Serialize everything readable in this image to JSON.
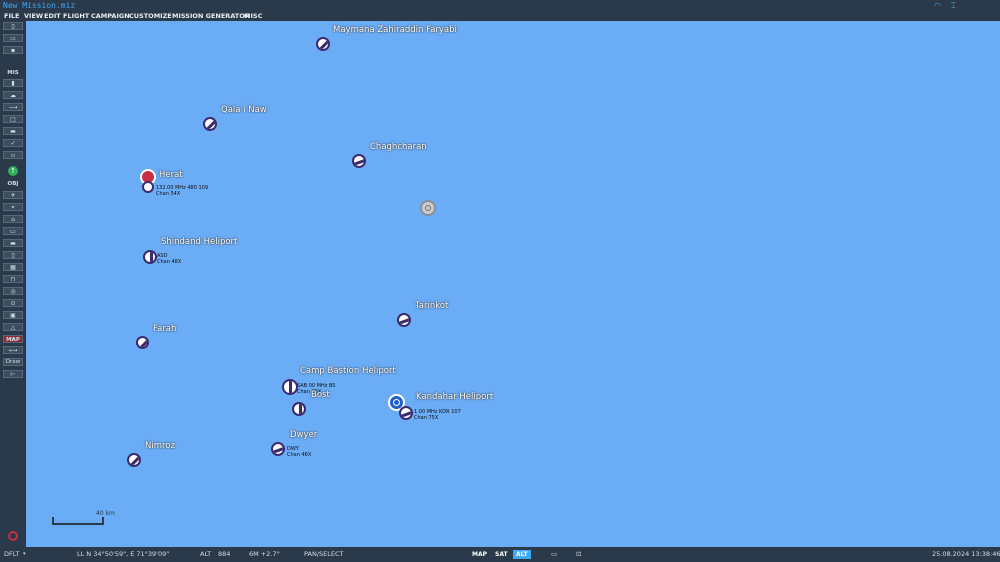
{
  "window": {
    "title": "New Mission.miz"
  },
  "menu": [
    "FILE",
    "VIEW",
    "EDIT",
    "FLIGHT",
    "CAMPAIGN",
    "CUSTOMIZE",
    "MISSION GENERATOR",
    "MISC"
  ],
  "sidebar": {
    "section_mis": "MIS",
    "section_obj": "OBJ",
    "section_map": "MAP",
    "draw_label": "Draw"
  },
  "airfields": [
    {
      "name": "Maymana Zahiraddin Faryabi"
    },
    {
      "name": "Qala i Naw"
    },
    {
      "name": "Chaghcharan"
    },
    {
      "name": "Herat",
      "info": [
        "132.00 MHz 480 109",
        "Chan 54X"
      ]
    },
    {
      "name": "Shindand Heliport",
      "info": [
        "ASD",
        "Chan 48X"
      ]
    },
    {
      "name": "Tarinkot"
    },
    {
      "name": "Farah"
    },
    {
      "name": "Camp Bastion Heliport",
      "info": [
        "SAB 00 MHz BS",
        "Chan 96X"
      ]
    },
    {
      "name": "Bost"
    },
    {
      "name": "Kandahar Heliport",
      "info": [
        "1 00 MHz KDR 107",
        "Chan 75X"
      ]
    },
    {
      "name": "Dwyer",
      "info": [
        "DWY",
        "Chan 46X"
      ]
    },
    {
      "name": "Nimroz"
    }
  ],
  "scale_bar": {
    "label": "40 km"
  },
  "status": {
    "layout": "DFLT",
    "coords": "LL  N 34°50'59\", E 71°39'09\"",
    "alt_label": "ALT",
    "alt_value": "884",
    "mag": "6M  +2.7°",
    "mode": "PAN/SELECT",
    "map_btn": "MAP",
    "sat_btn": "SAT",
    "alt_btn": "ALT",
    "datetime": "25.08.2024 13:38:46"
  },
  "colors": {
    "map_bg": "#6aacf6",
    "chrome": "#2b3a4a",
    "red_coalition": "#c62f45",
    "blue_coalition": "#1f5fd1"
  }
}
